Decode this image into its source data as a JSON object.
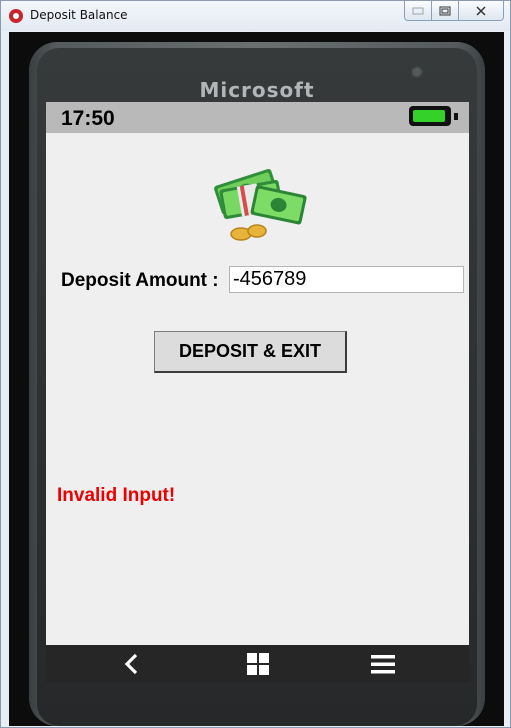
{
  "window": {
    "title": "Deposit Balance",
    "controls": {
      "minimize": "▭",
      "maximize": "⧉",
      "close": "✕"
    }
  },
  "phone": {
    "brand": "Microsoft"
  },
  "status_bar": {
    "time": "17:50",
    "battery_level": 0.95,
    "battery_color": "#33d12a"
  },
  "main": {
    "deposit_label": "Deposit Amount :",
    "deposit_value": "-456789",
    "deposit_button": "DEPOSIT & EXIT",
    "error_message": "Invalid Input!",
    "error_color": "#ee0000",
    "illustration": "money-stack-icon"
  },
  "nav_bar": {
    "items": [
      "back-icon",
      "windows-icon",
      "menu-icon"
    ]
  }
}
